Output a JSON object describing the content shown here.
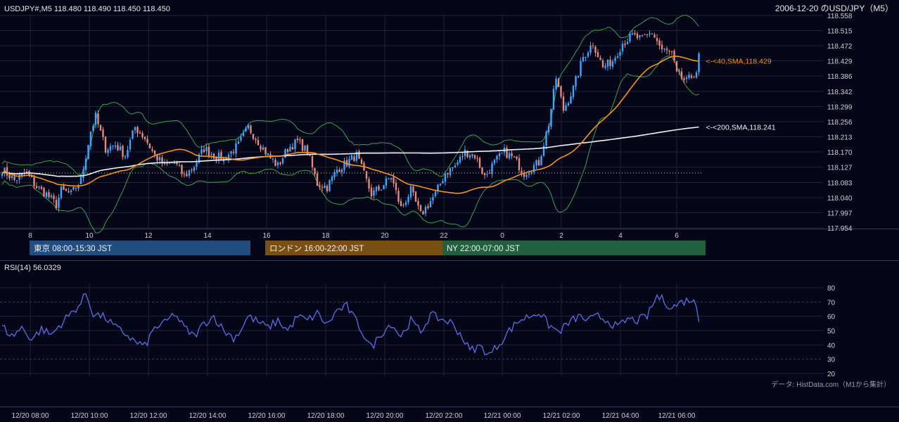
{
  "header": {
    "symbol_info": "USDJPY#,M5 118.480 118.490 118.450 118.450",
    "date_title": "2006-12-20 のUSD/JPY（M5）"
  },
  "chart_data": {
    "type": "candlestick",
    "price_axis": {
      "ylim": [
        117.954,
        118.558
      ],
      "tick_labels": [
        "118.558",
        "118.515",
        "118.472",
        "118.429",
        "118.386",
        "118.342",
        "118.299",
        "118.256",
        "118.213",
        "118.170",
        "118.127",
        "118.083",
        "118.040",
        "117.997",
        "117.954"
      ]
    },
    "hour_axis_labels": [
      "8",
      "10",
      "12",
      "14",
      "16",
      "18",
      "20",
      "22",
      "0",
      "2",
      "4",
      "6"
    ],
    "time_axis_labels": [
      "12/20 08:00",
      "12/20 10:00",
      "12/20 12:00",
      "12/20 14:00",
      "12/20 16:00",
      "12/20 18:00",
      "12/20 20:00",
      "12/20 22:00",
      "12/21 00:00",
      "12/21 02:00",
      "12/21 04:00",
      "12/21 06:00"
    ],
    "bar_count": 284,
    "last_price": 118.45,
    "reference_level": 118.11,
    "price_path": [
      [
        0,
        118.12
      ],
      [
        5,
        118.09
      ],
      [
        10,
        118.11
      ],
      [
        14,
        118.07
      ],
      [
        18,
        118.05
      ],
      [
        22,
        118.02
      ],
      [
        24,
        118.06
      ],
      [
        28,
        118.05
      ],
      [
        32,
        118.09
      ],
      [
        36,
        118.23
      ],
      [
        38,
        118.27
      ],
      [
        42,
        118.18
      ],
      [
        46,
        118.19
      ],
      [
        50,
        118.16
      ],
      [
        54,
        118.24
      ],
      [
        58,
        118.21
      ],
      [
        62,
        118.16
      ],
      [
        66,
        118.13
      ],
      [
        70,
        118.14
      ],
      [
        74,
        118.1
      ],
      [
        78,
        118.13
      ],
      [
        82,
        118.18
      ],
      [
        86,
        118.16
      ],
      [
        90,
        118.15
      ],
      [
        96,
        118.19
      ],
      [
        100,
        118.24
      ],
      [
        104,
        118.2
      ],
      [
        108,
        118.16
      ],
      [
        112,
        118.13
      ],
      [
        116,
        118.18
      ],
      [
        120,
        118.2
      ],
      [
        124,
        118.17
      ],
      [
        128,
        118.08
      ],
      [
        132,
        118.07
      ],
      [
        136,
        118.12
      ],
      [
        140,
        118.14
      ],
      [
        144,
        118.16
      ],
      [
        150,
        118.05
      ],
      [
        154,
        118.07
      ],
      [
        158,
        118.1
      ],
      [
        162,
        118.01
      ],
      [
        166,
        118.06
      ],
      [
        170,
        117.99
      ],
      [
        176,
        118.05
      ],
      [
        180,
        118.11
      ],
      [
        184,
        118.13
      ],
      [
        188,
        118.17
      ],
      [
        192,
        118.16
      ],
      [
        196,
        118.1
      ],
      [
        200,
        118.14
      ],
      [
        204,
        118.17
      ],
      [
        208,
        118.15
      ],
      [
        212,
        118.11
      ],
      [
        218,
        118.14
      ],
      [
        222,
        118.25
      ],
      [
        225,
        118.38
      ],
      [
        228,
        118.29
      ],
      [
        232,
        118.35
      ],
      [
        236,
        118.44
      ],
      [
        240,
        118.48
      ],
      [
        244,
        118.41
      ],
      [
        248,
        118.43
      ],
      [
        252,
        118.48
      ],
      [
        256,
        118.5
      ],
      [
        260,
        118.49
      ],
      [
        264,
        118.51
      ],
      [
        268,
        118.46
      ],
      [
        272,
        118.45
      ],
      [
        274,
        118.39
      ],
      [
        278,
        118.37
      ],
      [
        282,
        118.4
      ],
      [
        286,
        118.42
      ],
      [
        290,
        118.44
      ],
      [
        294,
        118.43
      ],
      [
        298,
        118.46
      ],
      [
        302,
        118.45
      ]
    ],
    "series": [
      {
        "name": "<-<40,SMA,118.429",
        "color": "#f5931e",
        "end_value": 118.429
      },
      {
        "name": "<-<200,SMA,118.241",
        "color": "#f2f2f2",
        "end_value": 118.241
      },
      {
        "name": "Bollinger Bands",
        "color": "#3fa14a"
      }
    ],
    "colors": {
      "up": "#3fa6ff",
      "down": "#e8897a",
      "grid": "#202238",
      "text": "#e6e6e6"
    }
  },
  "sessions": [
    {
      "label": "東京 08:00-15:30 JST",
      "color": "#204d7e"
    },
    {
      "label": "ロンドン 16:00-22:00 JST",
      "color": "#7a4f14"
    },
    {
      "label": "NY 22:00-07:00 JST",
      "color": "#22613f"
    }
  ],
  "rsi": {
    "label": "RSI(14) 56.0329",
    "value": 56.0329,
    "ylim": [
      20,
      80
    ],
    "tick_labels": [
      "80",
      "70",
      "60",
      "50",
      "40",
      "30",
      "20"
    ],
    "levels": [
      30,
      70
    ],
    "color": "#5d6ee8",
    "path": [
      [
        0,
        53
      ],
      [
        4,
        46
      ],
      [
        8,
        52
      ],
      [
        12,
        44
      ],
      [
        16,
        51
      ],
      [
        20,
        47
      ],
      [
        24,
        55
      ],
      [
        28,
        62
      ],
      [
        32,
        69
      ],
      [
        34,
        76
      ],
      [
        37,
        62
      ],
      [
        42,
        59
      ],
      [
        46,
        52
      ],
      [
        50,
        48
      ],
      [
        54,
        42
      ],
      [
        58,
        39
      ],
      [
        62,
        52
      ],
      [
        66,
        55
      ],
      [
        70,
        62
      ],
      [
        74,
        52
      ],
      [
        78,
        46
      ],
      [
        82,
        55
      ],
      [
        86,
        60
      ],
      [
        90,
        50
      ],
      [
        94,
        45
      ],
      [
        96,
        48
      ],
      [
        100,
        60
      ],
      [
        104,
        56
      ],
      [
        108,
        52
      ],
      [
        112,
        57
      ],
      [
        116,
        50
      ],
      [
        120,
        60
      ],
      [
        124,
        57
      ],
      [
        128,
        62
      ],
      [
        132,
        54
      ],
      [
        136,
        64
      ],
      [
        140,
        67
      ],
      [
        144,
        56
      ],
      [
        150,
        38
      ],
      [
        154,
        48
      ],
      [
        158,
        55
      ],
      [
        162,
        46
      ],
      [
        166,
        57
      ],
      [
        170,
        49
      ],
      [
        174,
        61
      ],
      [
        178,
        58
      ],
      [
        182,
        56
      ],
      [
        186,
        48
      ],
      [
        190,
        36
      ],
      [
        194,
        39
      ],
      [
        198,
        33
      ],
      [
        202,
        41
      ],
      [
        206,
        50
      ],
      [
        210,
        57
      ],
      [
        214,
        60
      ],
      [
        218,
        63
      ],
      [
        222,
        54
      ],
      [
        226,
        49
      ],
      [
        230,
        55
      ],
      [
        234,
        60
      ],
      [
        238,
        57
      ],
      [
        242,
        60
      ],
      [
        246,
        57
      ],
      [
        250,
        52
      ],
      [
        254,
        58
      ],
      [
        258,
        57
      ],
      [
        262,
        60
      ],
      [
        266,
        74
      ],
      [
        268,
        72
      ],
      [
        272,
        66
      ],
      [
        276,
        70
      ],
      [
        280,
        72
      ],
      [
        284,
        62
      ],
      [
        288,
        58
      ],
      [
        290,
        55
      ],
      [
        292,
        43
      ],
      [
        296,
        38
      ],
      [
        300,
        45
      ],
      [
        304,
        46
      ],
      [
        308,
        52
      ],
      [
        312,
        53
      ],
      [
        316,
        52
      ],
      [
        320,
        57
      ],
      [
        324,
        46
      ],
      [
        328,
        52
      ],
      [
        332,
        59
      ],
      [
        334,
        57
      ]
    ]
  },
  "watermark": "データ: HistData.com（M1から集計）"
}
